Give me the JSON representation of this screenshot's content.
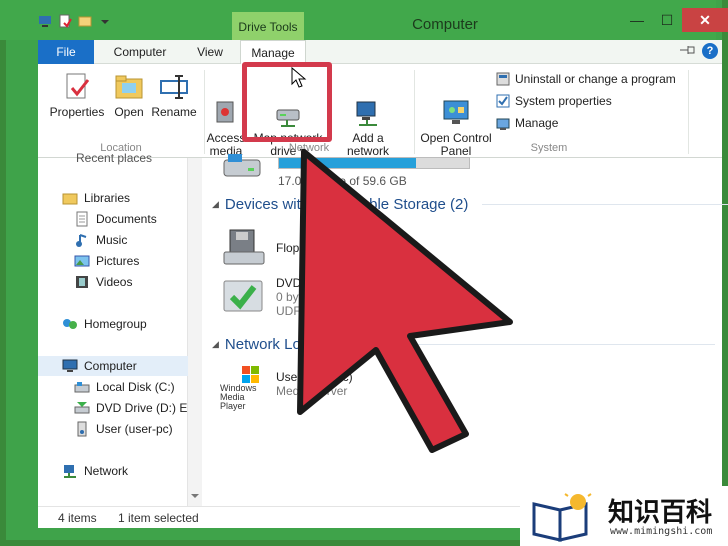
{
  "window": {
    "title": "Computer",
    "contextual_tab": "Drive Tools",
    "buttons": {
      "minimize": "—",
      "maximize": "☐",
      "close": "✕"
    }
  },
  "ribbon_tabs": [
    {
      "label": "File"
    },
    {
      "label": "Computer"
    },
    {
      "label": "View"
    },
    {
      "label": "Manage"
    }
  ],
  "ribbon": {
    "location": {
      "label": "Location",
      "buttons": [
        {
          "label": "Properties"
        },
        {
          "label": "Open"
        },
        {
          "label": "Rename"
        }
      ]
    },
    "network": {
      "label": "Network",
      "access_media": "Access\nmedia",
      "map_network_drive": "Map network\ndrive ▾",
      "add_network_location": "Add a network\nlocation"
    },
    "system": {
      "label": "System",
      "open_control_panel": "Open Control\nPanel",
      "uninstall": "Uninstall or change a program",
      "system_properties": "System properties",
      "manage": "Manage"
    }
  },
  "nav": {
    "recent_places": "Recent places",
    "libraries": "Libraries",
    "documents": "Documents",
    "music": "Music",
    "pictures": "Pictures",
    "videos": "Videos",
    "homegroup": "Homegroup",
    "computer": "Computer",
    "local_disk": "Local Disk (C:)",
    "dvd_drive": "DVD Drive (D:) ES",
    "user": "User (user-pc)",
    "network": "Network"
  },
  "content": {
    "local_disk_usage_text": "17.0 GB free of 59.6 GB",
    "local_disk_used_fraction": 0.72,
    "sections": {
      "removable": "Devices with Removable Storage (2)",
      "network": "Network Location"
    },
    "floppy": "Floppy Disk Drive (A:)",
    "dvd_title": "DVD Drive (D:)",
    "dvd_line2": "0 bytes free",
    "dvd_line3": "UDF",
    "user_title": "User (user-pc)",
    "user_sub": "Media Server",
    "wmp_logo": "Windows\nMedia Player"
  },
  "status": {
    "items": "4 items",
    "selected": "1 item selected"
  },
  "watermark": {
    "chinese": "知识百科",
    "url": "www.mimingshi.com"
  },
  "colors": {
    "titlebar": "#41a84b",
    "file_tab": "#1a6fc7",
    "highlight": "#d33a4c",
    "arrow": "#d9303f"
  }
}
